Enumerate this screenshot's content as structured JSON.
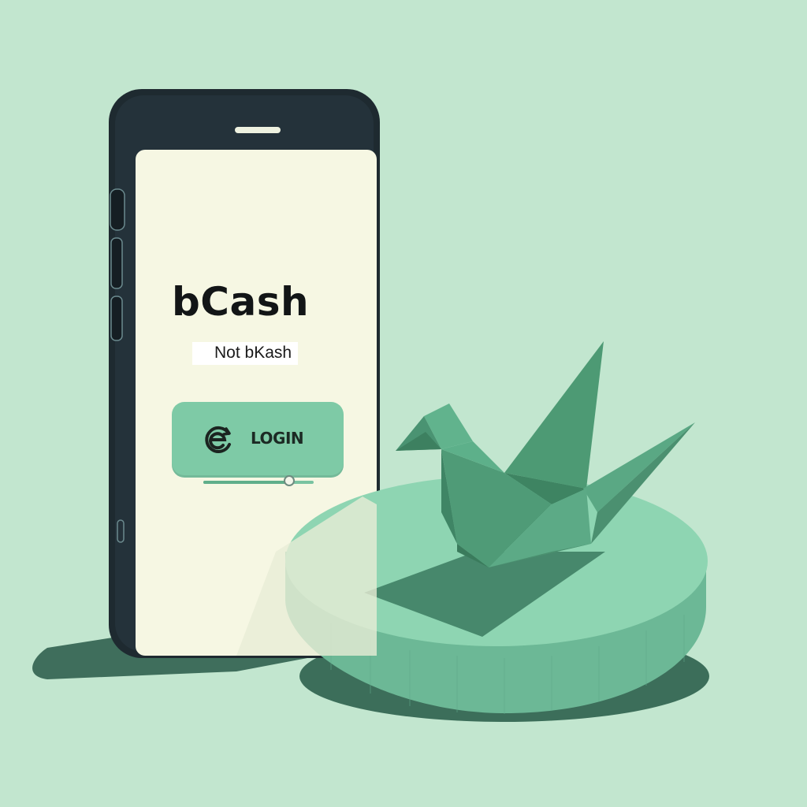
{
  "app": {
    "name": "bCash",
    "tagline": "Not bKash"
  },
  "login": {
    "label": "LOGIN",
    "icon": "refresh-e-icon"
  },
  "progress": {
    "value": 0.78
  },
  "decor": {
    "object": "origami-crane-icon",
    "pedestal": "round-pedestal"
  },
  "colors": {
    "background": "#c2e6cf",
    "screen": "#f6f7e3",
    "phone_body": "#1e2a30",
    "accent": "#7ecaa6",
    "crane": "#4d9a74"
  }
}
